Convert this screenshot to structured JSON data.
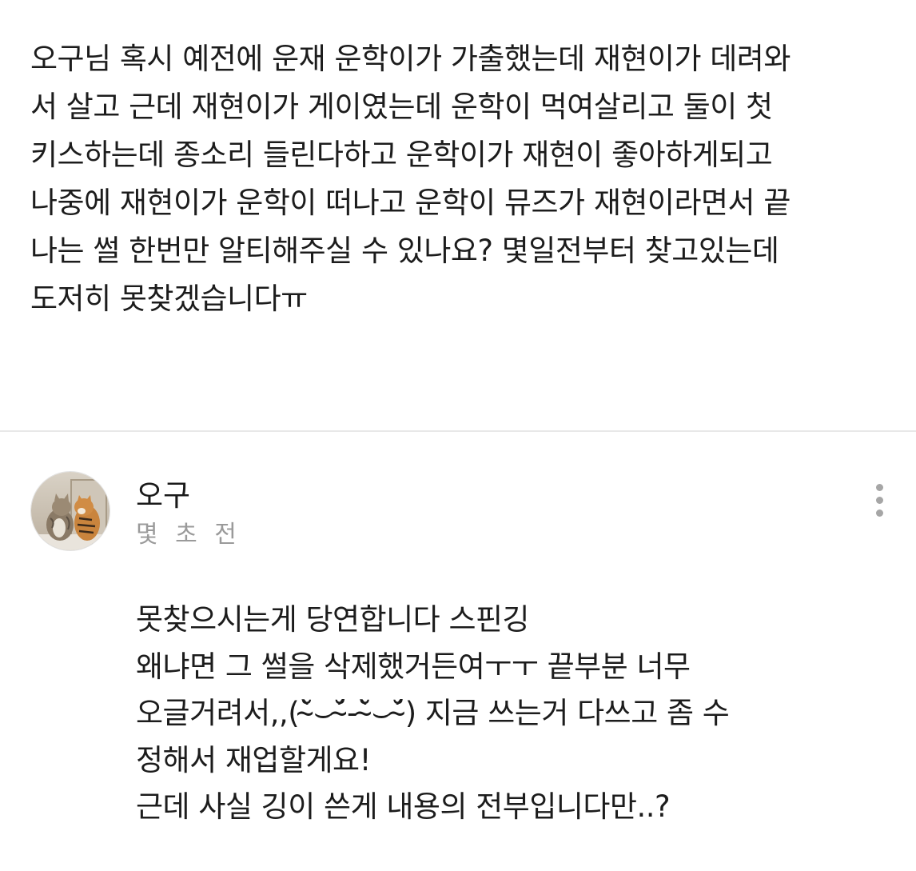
{
  "question": {
    "lines": [
      "오구님 혹시 예전에 운재 운학이가 가출했는데 재현이가 데려와",
      "서 살고 근데 재현이가 게이였는데 운학이 먹여살리고 둘이 첫",
      "키스하는데 종소리 들린다하고 운학이가 재현이 좋아하게되고",
      "나중에 재현이가 운학이 떠나고 운학이 뮤즈가 재현이라면서 끝",
      "나는 썰 한번만 알티해주실 수 있나요? 몇일전부터 찾고있는데",
      "도저히 못찾겠습니다ㅠ"
    ]
  },
  "answer": {
    "author": "오구",
    "timestamp": "몇 초 전",
    "more_icon": "more-vertical-icon",
    "avatar_icon": "cat-and-tiger-photo",
    "lines": [
      "못찾으시는게 당연합니다 스핀깅",
      "왜냐면 그 썰을 삭제했거든여ㅜㅜ 끝부분 너무",
      "오글거려서,,(˘̴̀⌣˘̴́-˘̴̀⌣˘̴́) 지금 쓰는거 다쓰고 좀 수",
      "정해서 재업할게요!",
      "근데 사실 깅이 쓴게 내용의 전부입니다만..?"
    ]
  },
  "colors": {
    "text": "#1c1c1c",
    "muted": "#9a9a9a",
    "divider": "#e8e8e8",
    "background": "#ffffff"
  }
}
